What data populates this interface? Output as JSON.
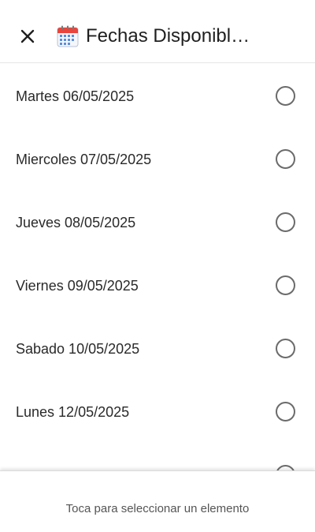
{
  "header": {
    "close_icon": "close-icon",
    "calendar_icon": "calendar-icon",
    "title": "Fechas Disponibl…"
  },
  "dates": [
    {
      "label": "Martes 06/05/2025",
      "selected": false
    },
    {
      "label": "Miercoles 07/05/2025",
      "selected": false
    },
    {
      "label": "Jueves 08/05/2025",
      "selected": false
    },
    {
      "label": "Viernes 09/05/2025",
      "selected": false
    },
    {
      "label": "Sabado 10/05/2025",
      "selected": false
    },
    {
      "label": "Lunes 12/05/2025",
      "selected": false
    },
    {
      "label": "",
      "selected": false
    }
  ],
  "footer": {
    "hint": "Toca para seleccionar un elemento"
  },
  "colors": {
    "radio_border": "#6b6b6b",
    "text": "#2a2a2a",
    "calendar_red": "#e8453c",
    "calendar_blue": "#5b8fd9"
  }
}
